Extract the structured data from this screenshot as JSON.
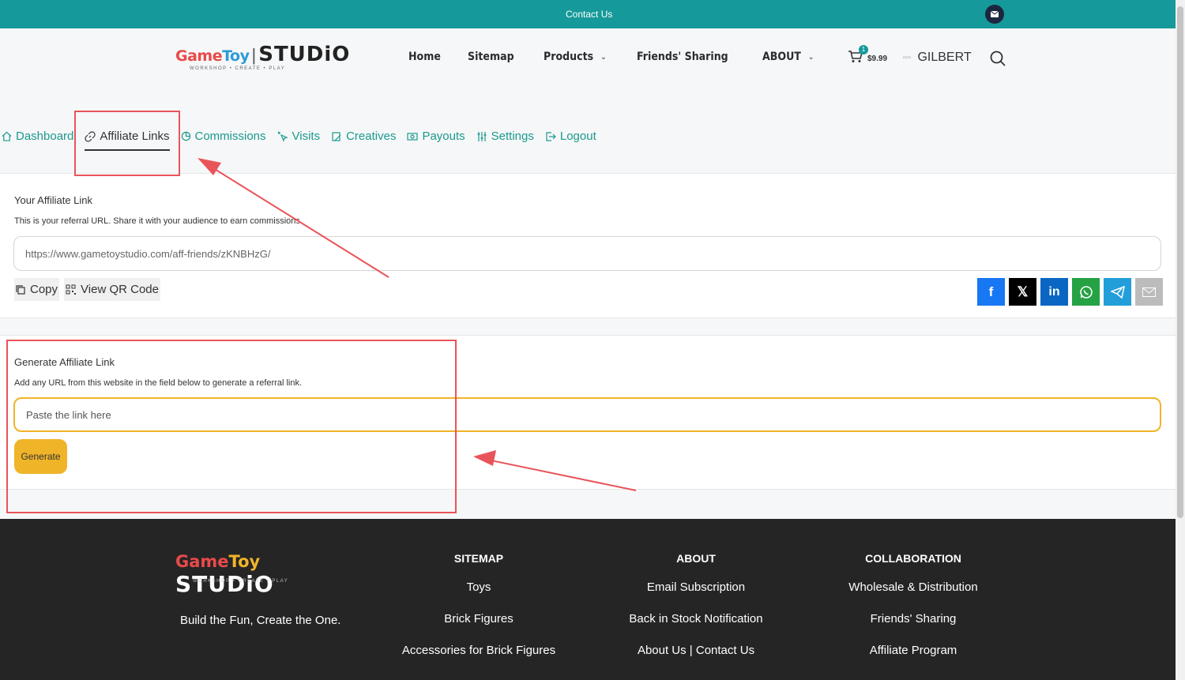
{
  "topbar": {
    "contact": "Contact Us",
    "mail_icon": "mail-icon"
  },
  "header": {
    "logo": {
      "game": "Game",
      "toy": "Toy",
      "studio": "STUDiO",
      "tagline": "WORKSHOP • CREATE • PLAY"
    },
    "nav": [
      {
        "label": "Home"
      },
      {
        "label": "Sitemap"
      },
      {
        "label": "Products",
        "dropdown": "⌄"
      },
      {
        "label": "Friends' Sharing"
      },
      {
        "label": "ABOUT",
        "dropdown": "⌄"
      }
    ],
    "cart": {
      "count": "1",
      "price": "$9.99"
    },
    "user": {
      "name": "GILBERT"
    }
  },
  "tabs": [
    {
      "label": "Dashboard",
      "icon": "home-icon"
    },
    {
      "label": "Affiliate Links",
      "icon": "link-icon",
      "active": true
    },
    {
      "label": "Commissions",
      "icon": "pie-chart-icon"
    },
    {
      "label": "Visits",
      "icon": "cursor-click-icon"
    },
    {
      "label": "Creatives",
      "icon": "creatives-icon"
    },
    {
      "label": "Payouts",
      "icon": "money-icon"
    },
    {
      "label": "Settings",
      "icon": "sliders-icon"
    },
    {
      "label": "Logout",
      "icon": "logout-icon"
    }
  ],
  "affiliate_link": {
    "title": "Your Affiliate Link",
    "description": "This is your referral URL. Share it with your audience to earn commissions.",
    "url": "https://www.gametoystudio.com/aff-friends/zKNBHzG/",
    "copy_label": "Copy",
    "qr_label": "View QR Code",
    "share": [
      {
        "name": "facebook",
        "color": "#1877f2"
      },
      {
        "name": "x",
        "color": "#000000"
      },
      {
        "name": "linkedin",
        "color": "#0a66c2"
      },
      {
        "name": "whatsapp",
        "color": "#25a244"
      },
      {
        "name": "telegram",
        "color": "#229ed9"
      },
      {
        "name": "email",
        "color": "#bcbcbc"
      }
    ]
  },
  "generate": {
    "title": "Generate Affiliate Link",
    "description": "Add any URL from this website in the field below to generate a referral link.",
    "placeholder": "Paste the link here",
    "button": "Generate"
  },
  "footer": {
    "slogan": "Build the Fun, Create the One.",
    "columns": [
      {
        "title": "SITEMAP",
        "links": [
          "Toys",
          "Brick Figures",
          "Accessories for Brick Figures"
        ]
      },
      {
        "title": "ABOUT",
        "links": [
          "Email Subscription",
          "Back in Stock Notification",
          "About Us | Contact Us"
        ]
      },
      {
        "title": "COLLABORATION",
        "links": [
          "Wholesale & Distribution",
          "Friends' Sharing",
          "Affiliate Program"
        ]
      }
    ]
  },
  "colors": {
    "teal": "#16999a",
    "gold": "#f0b429",
    "annotation_red": "#e9545a",
    "footer_bg": "#252525"
  }
}
